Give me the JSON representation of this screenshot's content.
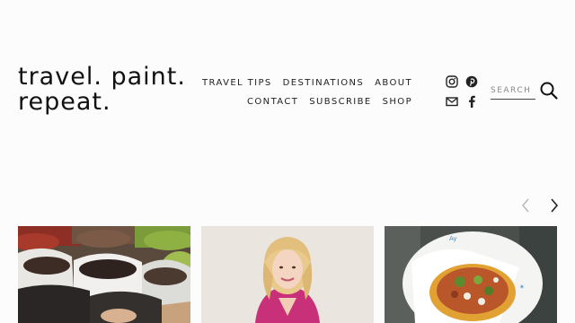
{
  "logo": {
    "line1": "travel. paint.",
    "line2": "repeat."
  },
  "nav": {
    "row1": [
      "TRAVEL TIPS",
      "DESTINATIONS",
      "ABOUT"
    ],
    "row2": [
      "CONTACT",
      "SUBSCRIBE",
      "SHOP"
    ]
  },
  "social": [
    "instagram-icon",
    "pinterest-icon",
    "email-icon",
    "facebook-icon"
  ],
  "search": {
    "placeholder": "SEARCH"
  },
  "carousel": {
    "cards": [
      {
        "image": "market-chiles-photo"
      },
      {
        "image": "woman-portrait-photo"
      },
      {
        "image": "tostada-plate-photo"
      }
    ]
  },
  "colors": {
    "text": "#1a1a1a",
    "background": "#fcfcfd",
    "muted": "#8a8a8a"
  }
}
